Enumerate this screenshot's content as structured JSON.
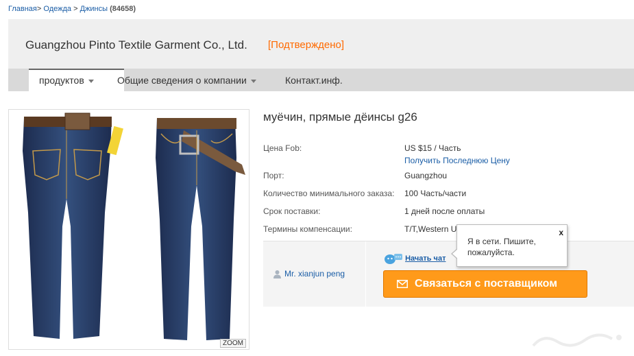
{
  "breadcrumb": {
    "home": "Главная",
    "separator": ">",
    "category": "Одежда",
    "subcategory": "Джинсы",
    "count": "(84658)"
  },
  "company": {
    "name": "Guangzhou Pinto Textile Garment Co., Ltd.",
    "status": "[Подтверждено]"
  },
  "nav": {
    "items": [
      {
        "label": "продуктов"
      },
      {
        "label": "Общие сведения о компании"
      },
      {
        "label": "Контакт.инф."
      }
    ]
  },
  "product": {
    "title": "муёчин, прямые дёинсы g26",
    "zoom_label": "ZOOM",
    "details": [
      {
        "label": "Цена Fob:",
        "value": "US $15 / Часть"
      },
      {
        "label": "Порт:",
        "value": "Guangzhou"
      },
      {
        "label": "Количество минимального заказа:",
        "value": "100 Часть/части"
      },
      {
        "label": "Срок поставки:",
        "value": "1 дней после оплаты"
      },
      {
        "label": "Термины компенсации:",
        "value": "T/T,Western U"
      }
    ],
    "latest_price_link": "Получить Последнюю Цену"
  },
  "contact": {
    "person": "Mr. xianjun peng",
    "chat_label": "Начать чат",
    "contact_button": "Связаться с поставщиком"
  },
  "popup": {
    "message": "Я в сети. Пишите, пожалуйста.",
    "close": "x"
  },
  "colors": {
    "accent_orange": "#ff6a00",
    "button_orange": "#ff9a1a",
    "link_blue": "#1a5da6"
  }
}
